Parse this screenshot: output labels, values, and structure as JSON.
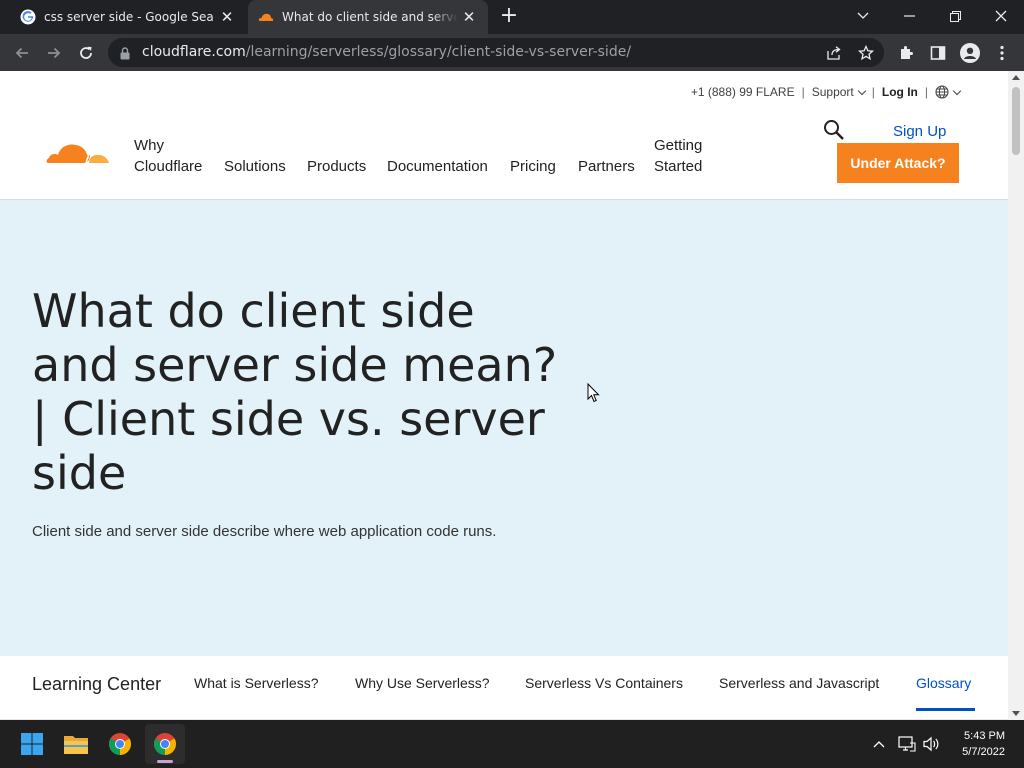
{
  "browser": {
    "tabs": [
      {
        "title": "css server side - Google Search",
        "icon": "google-icon"
      },
      {
        "title": "What do client side and server side mean? | Client side vs. server side",
        "icon": "cloudflare-icon"
      }
    ],
    "url_domain": "cloudflare.com",
    "url_path": "/learning/serverless/glossary/client-side-vs-server-side/"
  },
  "utility_bar": {
    "phone": "+1 (888) 99 FLARE",
    "separator": "|",
    "support": "Support",
    "login": "Log In"
  },
  "nav": {
    "items": [
      {
        "line1": "Why",
        "line2": "Cloudflare"
      },
      {
        "line1": "",
        "line2": "Solutions"
      },
      {
        "line1": "",
        "line2": "Products"
      },
      {
        "line1": "",
        "line2": "Documentation"
      },
      {
        "line1": "",
        "line2": "Pricing"
      },
      {
        "line1": "",
        "line2": "Partners"
      },
      {
        "line1": "Getting",
        "line2": "Started"
      }
    ],
    "signup": "Sign Up",
    "attack_button": "Under Attack?"
  },
  "hero": {
    "title": "What do client side and server side mean? | Client side vs. server side",
    "lede": "Client side and server side describe where web application code runs."
  },
  "subnav": {
    "title": "Learning Center",
    "items": [
      "What is Serverless?",
      "Why Use Serverless?",
      "Serverless Vs Containers",
      "Serverless and Javascript",
      "Glossary"
    ],
    "active_index": 4
  },
  "taskbar": {
    "time": "5:43 PM",
    "date": "5/7/2022"
  },
  "colors": {
    "accent_orange": "#f6821f",
    "link_blue": "#0051c3",
    "hero_bg": "#e3f2f9"
  }
}
